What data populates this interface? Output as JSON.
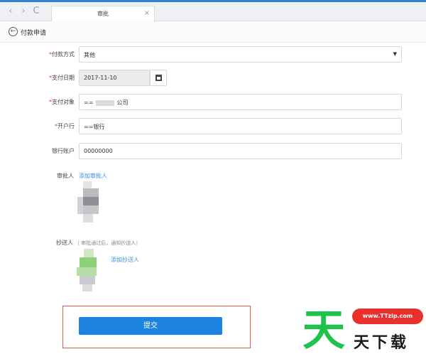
{
  "browser": {
    "nav_back": "‹",
    "nav_forward": "›",
    "nav_reload": "C",
    "tab_title": "审批",
    "tab_close": "×"
  },
  "page": {
    "back_icon": "←",
    "title": "付款申请"
  },
  "form": {
    "payment_method": {
      "label": "付款方式",
      "value": "其他",
      "required": true
    },
    "payment_date": {
      "label": "支付日期",
      "value": "2017-11-10",
      "required": true
    },
    "payee": {
      "label": "支付对象",
      "value_prefix": "==",
      "value_suffix": "公司",
      "required": true
    },
    "bank": {
      "label": "开户行",
      "value": "==银行",
      "required": true
    },
    "account": {
      "label": "银行账户",
      "value": "00000000",
      "required": false
    }
  },
  "approver": {
    "label": "审批人",
    "add_link": "添加审批人"
  },
  "cc": {
    "label": "抄送人",
    "hint": "（ 审批通过后，通知抄送人）",
    "add_link": "添加抄送人"
  },
  "submit": {
    "label": "提交"
  },
  "watermark": {
    "glyph": "天",
    "url": "www.TTzip.com",
    "text": "天下载"
  },
  "colors": {
    "accent": "#1c84e0",
    "required": "#e4393c",
    "link": "#3a8ee6",
    "highlight_border": "#e05a5a"
  }
}
